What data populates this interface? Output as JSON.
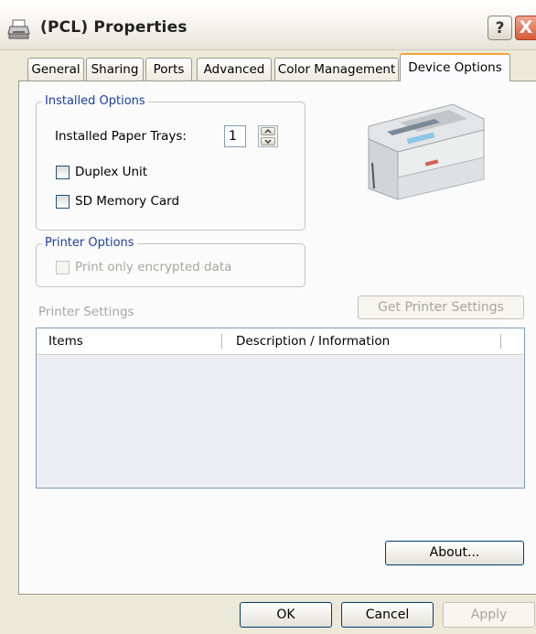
{
  "window": {
    "title": "(PCL) Properties",
    "help_label": "?",
    "close_label": "X"
  },
  "tabs": [
    {
      "label": "General"
    },
    {
      "label": "Sharing"
    },
    {
      "label": "Ports"
    },
    {
      "label": "Advanced"
    },
    {
      "label": "Color Management"
    },
    {
      "label": "Device Options",
      "active": true
    }
  ],
  "installed_options": {
    "legend": "Installed Options",
    "paper_trays_label": "Installed Paper Trays:",
    "paper_trays_value": "1",
    "duplex_label": "Duplex Unit",
    "duplex_checked": false,
    "sd_card_label": "SD Memory Card",
    "sd_card_checked": false
  },
  "printer_options": {
    "legend": "Printer Options",
    "encrypted_label": "Print only encrypted data",
    "encrypted_checked": false,
    "encrypted_enabled": false
  },
  "printer_settings": {
    "label": "Printer Settings",
    "get_button": "Get Printer Settings",
    "columns": [
      "Items",
      "Description / Information"
    ],
    "rows": []
  },
  "about_button": "About...",
  "footer": {
    "ok": "OK",
    "cancel": "Cancel",
    "apply": "Apply"
  },
  "colors": {
    "group_legend": "#1d3fa6",
    "active_tab_accent": "#f4a43a",
    "dialog_bg": "#ece9d8"
  }
}
